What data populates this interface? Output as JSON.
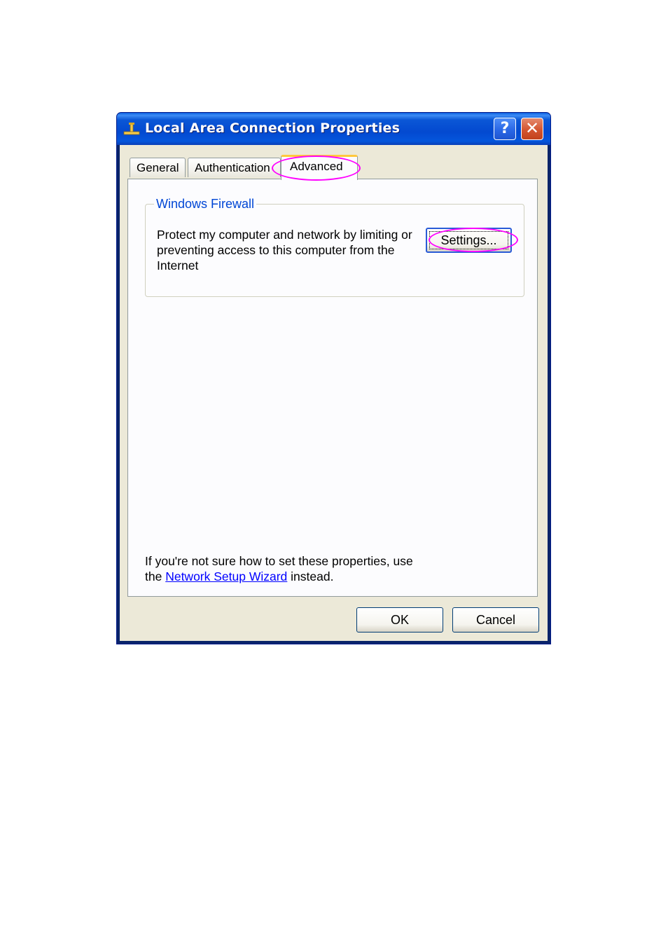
{
  "window": {
    "title": "Local Area Connection Properties",
    "help_label": "?",
    "close_label": "✕"
  },
  "tabs": [
    {
      "label": "General"
    },
    {
      "label": "Authentication"
    },
    {
      "label": "Advanced",
      "selected": true
    }
  ],
  "firewall": {
    "group_title": "Windows Firewall",
    "description": "Protect my computer and network by limiting or preventing access to this computer from the Internet",
    "settings_label": "Settings..."
  },
  "help": {
    "line1": "If you're not sure how to set these properties, use",
    "prefix": "the ",
    "link_text": "Network Setup Wizard",
    "suffix": " instead."
  },
  "buttons": {
    "ok_label": "OK",
    "cancel_label": "Cancel"
  },
  "colors": {
    "annotation": "#ff00ff",
    "titlebar": "#0349d0",
    "group_title": "#0046d5",
    "link": "#0000ff"
  }
}
